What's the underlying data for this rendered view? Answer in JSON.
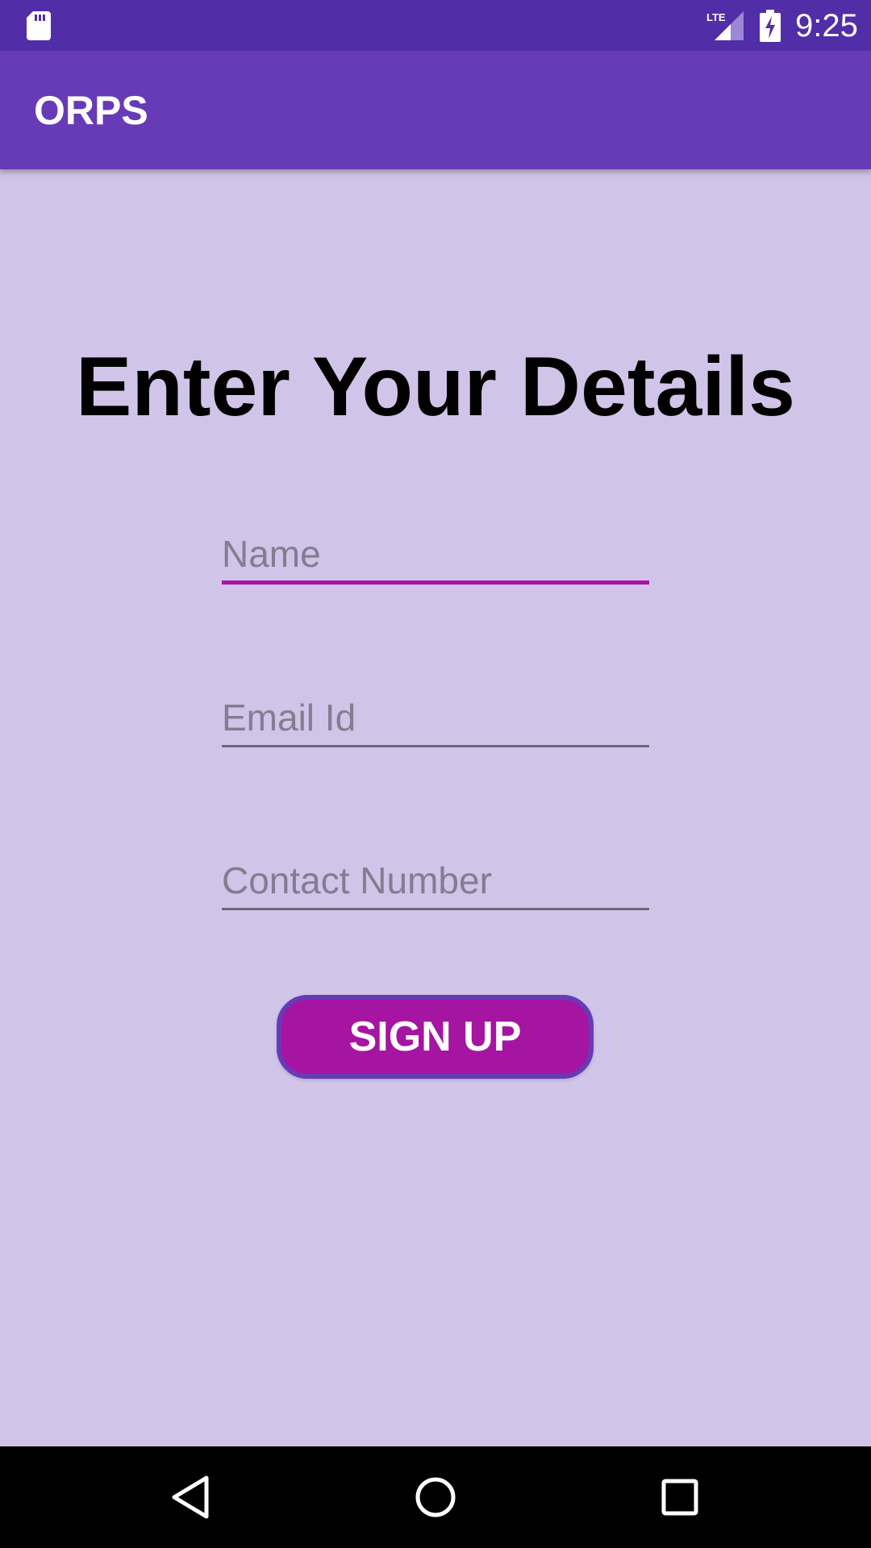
{
  "status_bar": {
    "network": "LTE",
    "time": "9:25",
    "icons": [
      "sd-card-icon",
      "lte-signal-icon",
      "battery-charging-icon"
    ]
  },
  "app_bar": {
    "title": "ORPS"
  },
  "form": {
    "heading": "Enter Your Details",
    "name_field": {
      "placeholder": "Name",
      "value": ""
    },
    "email_field": {
      "placeholder": "Email Id",
      "value": ""
    },
    "contact_field": {
      "placeholder": "Contact Number",
      "value": ""
    },
    "signup_label": "SIGN UP"
  },
  "nav_bar": {
    "icons": [
      "back-icon",
      "home-icon",
      "recents-icon"
    ]
  },
  "colors": {
    "status_bar": "#512DA8",
    "app_bar": "#673AB7",
    "background": "#D1C4E9",
    "accent": "#A614A2"
  }
}
